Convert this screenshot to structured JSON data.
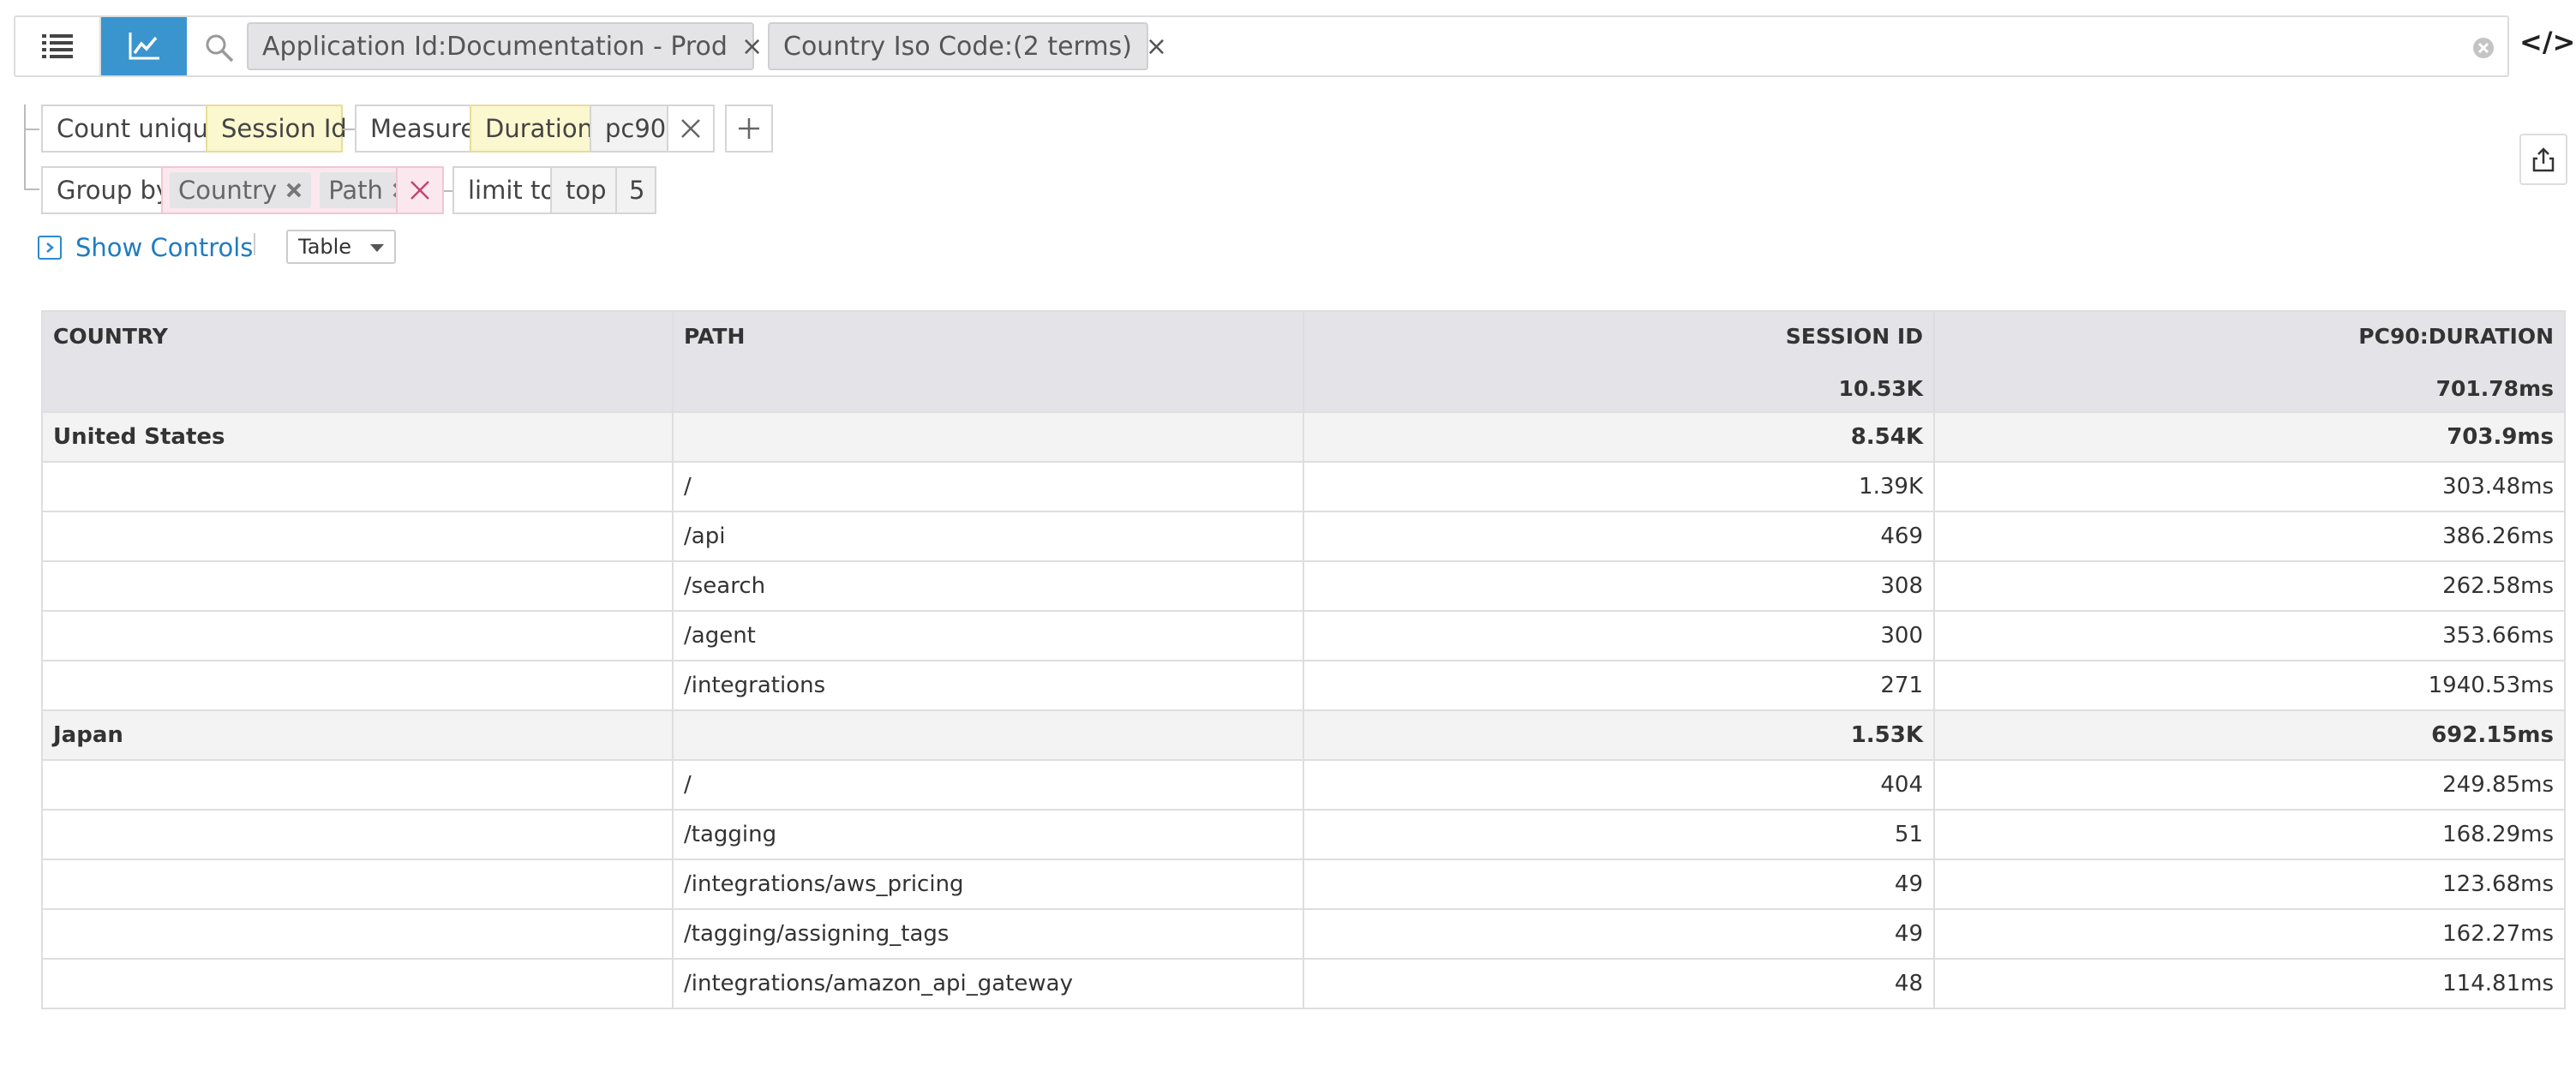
{
  "search": {
    "filters": [
      {
        "label": "Application Id:Documentation - Prod",
        "close": "×"
      },
      {
        "label": "Country Iso Code:(2 terms)",
        "close": "×"
      }
    ],
    "code_label": "</>"
  },
  "query": {
    "aggregation_label": "Count unique",
    "aggregation_field": "Session Id",
    "measure_label": "Measure",
    "measure_field": "Duration",
    "measure_stat": "pc90",
    "group_by_label": "Group by",
    "group_by_fields": [
      "Country",
      "Path"
    ],
    "limit_label": "limit to",
    "limit_mode": "top",
    "limit_value": "5"
  },
  "controls": {
    "show_controls_label": "Show Controls",
    "view_select": "Table"
  },
  "table": {
    "columns": [
      "COUNTRY",
      "PATH",
      "SESSION ID",
      "PC90:DURATION"
    ],
    "totals": [
      "",
      "",
      "10.53K",
      "701.78ms"
    ],
    "rows": [
      {
        "type": "group",
        "cells": [
          "United States",
          "",
          "8.54K",
          "703.9ms"
        ]
      },
      {
        "type": "row",
        "cells": [
          "",
          "/",
          "1.39K",
          "303.48ms"
        ]
      },
      {
        "type": "row",
        "cells": [
          "",
          "/api",
          "469",
          "386.26ms"
        ]
      },
      {
        "type": "row",
        "cells": [
          "",
          "/search",
          "308",
          "262.58ms"
        ]
      },
      {
        "type": "row",
        "cells": [
          "",
          "/agent",
          "300",
          "353.66ms"
        ]
      },
      {
        "type": "row",
        "cells": [
          "",
          "/integrations",
          "271",
          "1940.53ms"
        ]
      },
      {
        "type": "group",
        "cells": [
          "Japan",
          "",
          "1.53K",
          "692.15ms"
        ]
      },
      {
        "type": "row",
        "cells": [
          "",
          "/",
          "404",
          "249.85ms"
        ]
      },
      {
        "type": "row",
        "cells": [
          "",
          "/tagging",
          "51",
          "168.29ms"
        ]
      },
      {
        "type": "row",
        "cells": [
          "",
          "/integrations/aws_pricing",
          "49",
          "123.68ms"
        ]
      },
      {
        "type": "row",
        "cells": [
          "",
          "/tagging/assigning_tags",
          "49",
          "162.27ms"
        ]
      },
      {
        "type": "row",
        "cells": [
          "",
          "/integrations/amazon_api_gateway",
          "48",
          "114.81ms"
        ]
      }
    ]
  },
  "colors": {
    "accent": "#3a95cf",
    "link": "#1f7cc1",
    "yellow_field": "#fbf7cf",
    "pink_field": "#fbe8ee",
    "header_bg": "#e4e3e7"
  },
  "icons": {
    "list_view": "list-icon",
    "graph_view": "line-chart-icon",
    "search": "search-icon",
    "clear": "clear-circle-icon",
    "share": "export-icon"
  }
}
